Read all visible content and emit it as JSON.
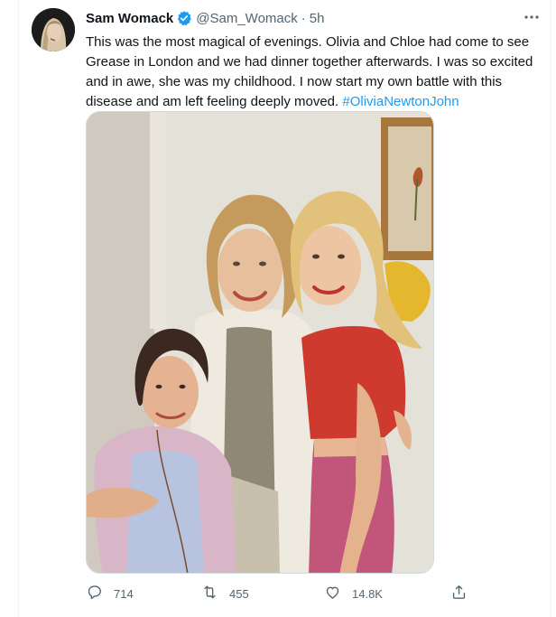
{
  "tweet": {
    "author_name": "Sam Womack",
    "handle": "@Sam_Womack",
    "separator": "·",
    "time": "5h",
    "text": "This was the most magical of evenings. Olivia and Chloe had come to see Grease in London and we had dinner together afterwards. I was so excited and in awe, she was my childhood. I now start my own battle with this disease and am left feeling deeply moved.",
    "hashtag": "#OliviaNewtonJohn",
    "more_icon": "···"
  },
  "actions": {
    "replies": "714",
    "retweets": "455",
    "likes": "14.8K"
  },
  "colors": {
    "text": "#0f1419",
    "secondary": "#536471",
    "link": "#1d9bf0",
    "border": "#eff3f4"
  },
  "icons": [
    "verified-badge-icon",
    "more-icon",
    "reply-icon",
    "retweet-icon",
    "like-icon",
    "share-icon"
  ]
}
